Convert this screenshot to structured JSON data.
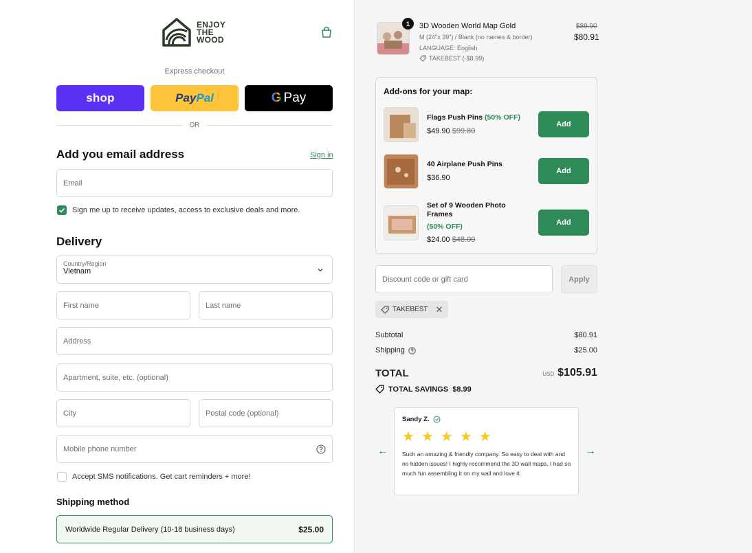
{
  "brand": {
    "logo_lines": [
      "ENJOY",
      "THE",
      "WOOD"
    ]
  },
  "express": {
    "label": "Express checkout",
    "shop_label": "shop",
    "paypal_part1": "Pay",
    "paypal_part2": "Pal",
    "gpay_g": "G",
    "gpay_label": "Pay",
    "or_label": "OR"
  },
  "contact": {
    "heading": "Add you email address",
    "signin_label": "Sign in",
    "email_placeholder": "Email",
    "newsletter_label": "Sign me up to receive updates, access to exclusive deals and more."
  },
  "delivery": {
    "heading": "Delivery",
    "country_label": "Country/Region",
    "country_value": "Vietnam",
    "first_name_placeholder": "First name",
    "last_name_placeholder": "Last name",
    "address_placeholder": "Address",
    "apartment_placeholder": "Apartment, suite, etc. (optional)",
    "city_placeholder": "City",
    "postal_placeholder": "Postal code (optional)",
    "phone_placeholder": "Mobile phone number",
    "sms_label": "Accept SMS notifications. Get cart reminders + more!"
  },
  "shipping": {
    "heading": "Shipping method",
    "option_label": "Worldwide Regular Delivery (10-18 business days)",
    "option_price": "$25.00"
  },
  "cart_item": {
    "quantity": "1",
    "title": "3D Wooden World Map Gold",
    "variant": "M (24\"x 39\") / Blank (no names & border)",
    "language": "LANGUAGE: English",
    "discount_tag": "TAKEBEST (-$8.99)",
    "old_price": "$89.90",
    "price": "$80.91"
  },
  "addons": {
    "title": "Add-ons for your map:",
    "items": [
      {
        "name": "Flags Push Pins",
        "off": "(50% OFF)",
        "price": "$49.90",
        "old_price": "$99.80",
        "button": "Add"
      },
      {
        "name": "40 Airplane Push Pins",
        "off": "",
        "price": "$36.90",
        "old_price": "",
        "button": "Add"
      },
      {
        "name": "Set of 9 Wooden Photo Frames",
        "off": "(50% OFF)",
        "price": "$24.00",
        "old_price": "$48.00",
        "button": "Add"
      }
    ]
  },
  "discount": {
    "placeholder": "Discount code or gift card",
    "apply_label": "Apply",
    "applied_code": "TAKEBEST"
  },
  "summary": {
    "subtotal_label": "Subtotal",
    "subtotal_value": "$80.91",
    "shipping_label": "Shipping",
    "shipping_value": "$25.00",
    "total_label": "TOTAL",
    "currency": "USD",
    "total_value": "$105.91",
    "savings_label": "TOTAL SAVINGS",
    "savings_value": "$8.99"
  },
  "review": {
    "author": "Sandy Z.",
    "rating": 5,
    "stars": [
      "★",
      "★",
      "★",
      "★",
      "★"
    ],
    "text": "Such an amazing & friendly company. So easy to deal with and no hidden issues! I highly recommend the 3D wall maps, I had so much fun assembling it on my wall and love it."
  },
  "colors": {
    "accent": "#2e8b57",
    "shop": "#5a31f4",
    "paypal": "#ffc439",
    "star": "#f4cb1f"
  }
}
